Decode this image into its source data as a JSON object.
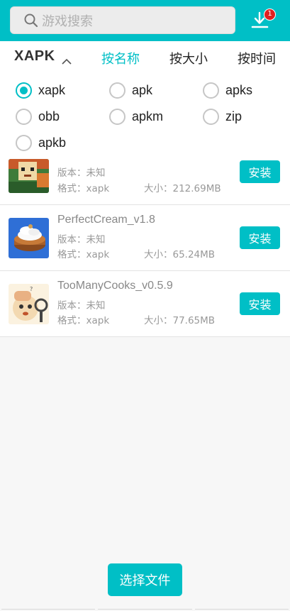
{
  "header": {
    "search_placeholder": "游戏搜索",
    "download_badge": "1",
    "icons": {
      "search": "search-icon",
      "download": "download-icon"
    }
  },
  "tabs": {
    "filetype": "XAPK",
    "items": [
      {
        "label": "按名称",
        "active": true
      },
      {
        "label": "按大小",
        "active": false
      },
      {
        "label": "按时间",
        "active": false
      }
    ]
  },
  "filters": [
    {
      "label": "xapk",
      "checked": true
    },
    {
      "label": "apk",
      "checked": false
    },
    {
      "label": "apks",
      "checked": false
    },
    {
      "label": "obb",
      "checked": false
    },
    {
      "label": "apkm",
      "checked": false
    },
    {
      "label": "zip",
      "checked": false
    },
    {
      "label": "apkb",
      "checked": false
    }
  ],
  "files": [
    {
      "name": "",
      "version": "版本：未知",
      "format": "格式：xapk",
      "size": "大小：212.69MB",
      "install_label": "安装"
    },
    {
      "name": "PerfectCream_v1.8",
      "version": "版本：未知",
      "format": "格式：xapk",
      "size": "大小：65.24MB",
      "install_label": "安装"
    },
    {
      "name": "TooManyCooks_v0.5.9",
      "version": "版本：未知",
      "format": "格式：xapk",
      "size": "大小：77.65MB",
      "install_label": "安装"
    }
  ],
  "footer": {
    "choose_label": "选择文件"
  },
  "colors": {
    "accent": "#00bfc6",
    "badge": "#e02020"
  }
}
